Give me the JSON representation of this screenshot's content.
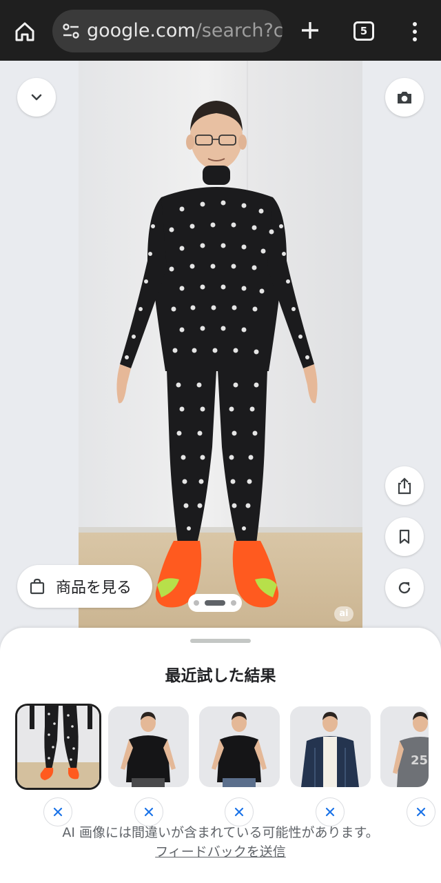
{
  "browser": {
    "url_host": "google.com",
    "url_rest": "/search?c",
    "tab_count": "5",
    "icons": [
      "home-icon",
      "site-settings-icon",
      "new-tab-icon",
      "tab-switcher-icon",
      "more-vert-icon"
    ]
  },
  "viewer": {
    "shop_label": "商品を見る",
    "ai_badge": "ai",
    "pager": {
      "pages": 3,
      "current": 2
    },
    "icons": [
      "chevron-down-icon",
      "camera-icon",
      "share-icon",
      "bookmark-icon",
      "refresh-icon",
      "shopping-bag-icon"
    ]
  },
  "sheet": {
    "title": "最近試した結果",
    "thumbnails": [
      {
        "outfit": "dotted leggings + orange shoes",
        "selected": true
      },
      {
        "outfit": "black t-shirt",
        "selected": false
      },
      {
        "outfit": "black t-shirt",
        "selected": false
      },
      {
        "outfit": "denim jacket over white shirt",
        "selected": false
      },
      {
        "outfit": "gray graphic t-shirt",
        "selected": false
      }
    ],
    "disclaimer": "AI 画像には間違いが含まれている可能性があります。",
    "feedback_link": "フィードバックを送信"
  },
  "colors": {
    "chrome_bg": "#1f1f1f",
    "urlbar_bg": "#3a3a3a",
    "stage_bg": "#e9ebef",
    "shoe_orange": "#ff5a1f",
    "remove_x": "#1a73e8"
  }
}
